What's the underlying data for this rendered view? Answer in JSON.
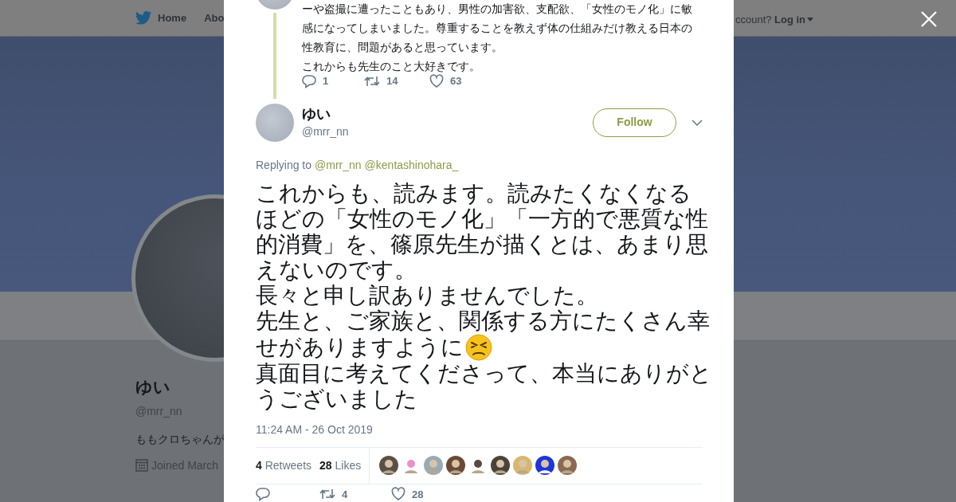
{
  "background_page": {
    "nav": {
      "home": "Home",
      "about": "Abo",
      "account_prompt": "ccount?",
      "login": "Log in"
    },
    "profile": {
      "name": "ゆい",
      "handle": "@mrr_nn",
      "bio": "ももクロちゃんが",
      "joined": "Joined March"
    }
  },
  "modal": {
    "parent_tweet": {
      "paragraphs": [
        "ーや盗撮に遭ったこともあり、男性の加害欲、支配欲、「女性のモノ化」に敏感になってしまいました。尊重することを教えず体の仕組みだけ教える日本の性教育に、問題があると思っています。",
        "これからも先生のこと大好きです。"
      ],
      "replies": "1",
      "retweets": "14",
      "likes": "63"
    },
    "author": {
      "name": "ゆい",
      "handle": "@mrr_nn"
    },
    "follow_button": "Follow",
    "replying_to": {
      "label": "Replying to",
      "mentions": [
        "@mrr_nn",
        "@kentashinohara_"
      ]
    },
    "text_paragraphs": [
      {
        "kind": "text",
        "text": "これからも、読みます。読みたくなくなるほどの「女性のモノ化」「一方的で悪質な性的消費」を、篠原先生が描くとは、あまり思えないのです。"
      },
      {
        "kind": "text",
        "text": "長々と申し訳ありませんでした。"
      },
      {
        "kind": "text",
        "text": "先生と、ご家族と、関係する方にたくさん幸"
      },
      {
        "kind": "emoji_line",
        "text": "せがありますように"
      },
      {
        "kind": "text",
        "text": "真面目に考えてくださって、本当にありがとうございました"
      }
    ],
    "timestamp": "11:24 AM - 26 Oct 2019",
    "stats": [
      {
        "count": "4",
        "label": "Retweets"
      },
      {
        "count": "28",
        "label": "Likes"
      }
    ],
    "actions": {
      "retweets": "4",
      "likes": "28"
    }
  }
}
